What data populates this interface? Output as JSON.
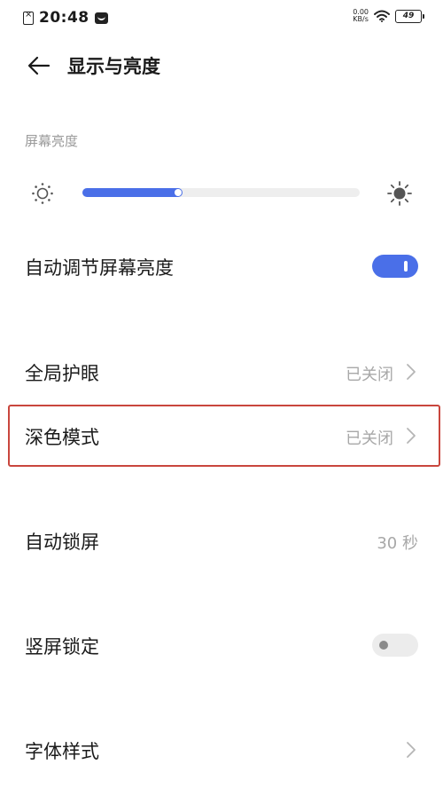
{
  "status_bar": {
    "time": "20:48",
    "net_speed_value": "0.00",
    "net_speed_unit": "KB/s",
    "battery_level": "49",
    "icons": [
      "notification-icon",
      "message-icon",
      "wifi-icon",
      "battery-icon"
    ]
  },
  "header": {
    "title": "显示与亮度",
    "back_icon": "arrow-left-icon"
  },
  "brightness": {
    "section_label": "屏幕亮度",
    "level": 0.36,
    "accent_color": "#4a6fe8"
  },
  "settings": {
    "auto_brightness": {
      "label": "自动调节屏幕亮度",
      "enabled": true
    },
    "eye_protection": {
      "label": "全局护眼",
      "value": "已关闭"
    },
    "dark_mode": {
      "label": "深色模式",
      "value": "已关闭"
    },
    "auto_lock": {
      "label": "自动锁屏",
      "value": "30 秒"
    },
    "portrait_lock": {
      "label": "竖屏锁定",
      "enabled": false
    },
    "font_style": {
      "label": "字体样式"
    }
  },
  "colors": {
    "accent": "#4a6fe8",
    "highlight_border": "#c9463d",
    "secondary_text": "#a8a8a8"
  }
}
